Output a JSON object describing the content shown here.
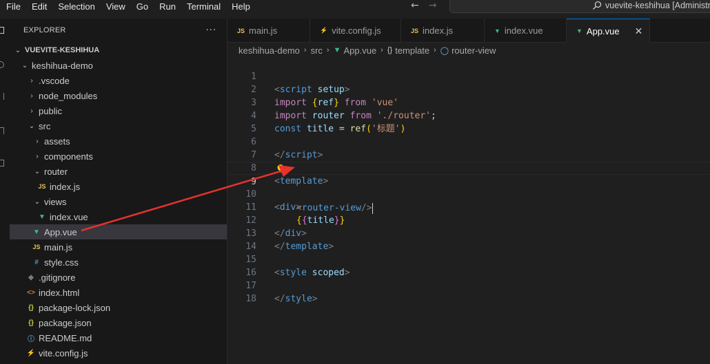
{
  "menu": [
    "File",
    "Edit",
    "Selection",
    "View",
    "Go",
    "Run",
    "Terminal",
    "Help"
  ],
  "command_center": {
    "text": "vuevite-keshihua [Administrator]"
  },
  "sidebar": {
    "title": "EXPLORER",
    "more": "···",
    "root": "VUEVITE-KESHIHUA",
    "items": [
      {
        "label": "keshihua-demo",
        "type": "folder-open"
      },
      {
        "label": ".vscode",
        "type": "folder"
      },
      {
        "label": "node_modules",
        "type": "folder"
      },
      {
        "label": "public",
        "type": "folder"
      },
      {
        "label": "src",
        "type": "folder-open"
      },
      {
        "label": "assets",
        "type": "folder"
      },
      {
        "label": "components",
        "type": "folder"
      },
      {
        "label": "router",
        "type": "folder-open"
      },
      {
        "label": "index.js",
        "type": "js"
      },
      {
        "label": "views",
        "type": "folder-open"
      },
      {
        "label": "index.vue",
        "type": "vue"
      },
      {
        "label": "App.vue",
        "type": "vue"
      },
      {
        "label": "main.js",
        "type": "js"
      },
      {
        "label": "style.css",
        "type": "css"
      },
      {
        "label": ".gitignore",
        "type": "git"
      },
      {
        "label": "index.html",
        "type": "html"
      },
      {
        "label": "package-lock.json",
        "type": "json"
      },
      {
        "label": "package.json",
        "type": "json"
      },
      {
        "label": "README.md",
        "type": "info"
      },
      {
        "label": "vite.config.js",
        "type": "vite"
      }
    ]
  },
  "tabs": [
    {
      "label": "main.js",
      "icon": "JS"
    },
    {
      "label": "vite.config.js",
      "icon": "vite-icon"
    },
    {
      "label": "index.js",
      "icon": "JS"
    },
    {
      "label": "index.vue",
      "icon": "vue-icon"
    },
    {
      "label": "App.vue",
      "icon": "vue-icon",
      "active": true,
      "close": "✕"
    }
  ],
  "breadcrumb": {
    "project": "keshihua-demo",
    "folder": "src",
    "file": "App.vue",
    "section": "template",
    "section_icon": "{}",
    "element": "router-view"
  },
  "editor": {
    "current_line": 9,
    "line_numbers": [
      "1",
      "2",
      "3",
      "4",
      "5",
      "6",
      "7",
      "8",
      "9",
      "10",
      "11",
      "12",
      "13",
      "14",
      "15",
      "16",
      "17",
      "18"
    ],
    "tokens": {
      "l1_open": "<",
      "l1_tag": "script",
      "l1_attr": "setup",
      "l1_close": ">",
      "l2_kw": "import",
      "l2_b1": "{",
      "l2_var": "ref",
      "l2_b2": "}",
      "l2_from": "from",
      "l2_str": "'vue'",
      "l3_kw": "import",
      "l3_var": "router",
      "l3_from": "from",
      "l3_str": "'./router'",
      "l3_semi": ";",
      "l4_kw": "const",
      "l4_var": "title",
      "l4_eq": "=",
      "l4_fn": "ref",
      "l4_p1": "(",
      "l4_str": "'标题'",
      "l4_p2": ")",
      "l6_open": "</",
      "l6_tag": "script",
      "l6_close": ">",
      "l8_open": "<",
      "l8_tag": "template",
      "l8_close": ">",
      "l9_open": "<",
      "l9_tag": "router-view",
      "l9_close": "/>",
      "l10_open": "<",
      "l10_tag": "div",
      "l10_close": ">",
      "l11_b1": "{",
      "l11_b2": "{",
      "l11_var": "title",
      "l11_b3": "}",
      "l11_b4": "}",
      "l12_open": "</",
      "l12_tag": "div",
      "l12_close": ">",
      "l13_open": "</",
      "l13_tag": "template",
      "l13_close": ">",
      "l15_open": "<",
      "l15_tag": "style",
      "l15_attr": "scoped",
      "l15_close": ">",
      "l17_open": "</",
      "l17_tag": "style",
      "l17_close": ">"
    }
  },
  "colors": {
    "accent": "#0078d4",
    "annotation_arrow": "#e8322c",
    "vue": "#41b883",
    "js": "#e8c14b"
  }
}
